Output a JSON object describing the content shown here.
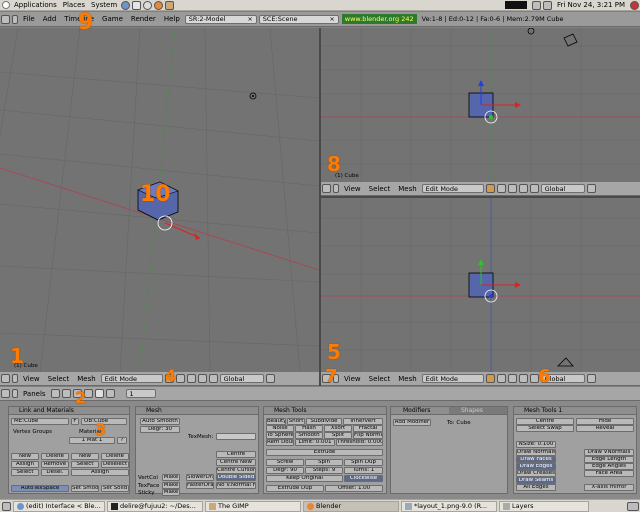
{
  "gnome_top": {
    "menus": [
      "Applications",
      "Places",
      "System"
    ],
    "datetime": "Fri Nov 24,  3:21 PM"
  },
  "blender_header": {
    "menus": [
      "File",
      "Add",
      "Timeline",
      "Game",
      "Render",
      "Help"
    ],
    "screen": "SR:2-Model",
    "scene": "SCE:Scene",
    "url": "www.blender.org 242",
    "stats": "Ve:1-8 | Ed:0-12 | Fa:0-6 | Mem:2.79M Cube"
  },
  "viewports": {
    "object_label": "(1) Cube",
    "menus": [
      "View",
      "Select",
      "Mesh"
    ],
    "mode": "Edit Mode",
    "orientation": "Global"
  },
  "buttons_header": {
    "panels_label": "Panels",
    "frame": "1"
  },
  "panels": {
    "link_materials": {
      "title": "Link and Materials",
      "me": "ME:Cube",
      "f": "F",
      "ob": "OB:Cube",
      "vertex_groups": "Vertex Groups",
      "material": "Material",
      "mat": "1 Mat 1",
      "q": "?",
      "buttons": [
        "New",
        "Delete",
        "New",
        "Delete",
        "Assign",
        "Remove",
        "Select",
        "Deselect",
        "Select",
        "Desel.",
        "Assign"
      ],
      "autotex": "AutoTexSpace",
      "set_smooth": "Set Smooth",
      "set_solid": "Set Solid"
    },
    "mesh": {
      "title": "Mesh",
      "auto_smooth": "Auto Smooth",
      "degr": "Degr: 30",
      "tex_mesh": "TexMesh:",
      "centre": "Centre",
      "centre_new": "Centre New",
      "centre_cursor": "Centre Cursor",
      "rows": [
        {
          "label": "VertCol",
          "btn": "Make"
        },
        {
          "label": "TexFace",
          "btn": "Make"
        },
        {
          "label": "Sticky",
          "btn": "Make"
        }
      ],
      "slower_draw": "SlowerDraw",
      "faster_draw": "FasterDraw",
      "double_sided": "Double Sided",
      "no_v_normal_flip": "No V.Normal Flip"
    },
    "mesh_tools": {
      "title": "Mesh Tools",
      "rows": [
        [
          "Beauty",
          "Short",
          "Subdivide",
          "Innervert"
        ],
        [
          "Noise",
          "Hash",
          "Xsort",
          "Fractal"
        ],
        [
          "To Sphere",
          "Smooth",
          "Split",
          "Flip Normals"
        ],
        [
          "Rem Doubles",
          "Limit: 0.001",
          "Threshold: 0.000"
        ]
      ],
      "extrude": "Extrude",
      "screw": "Screw",
      "spin": "Spin",
      "spin_dup": "Spin Dup",
      "degr": "Degr: 90",
      "steps": "Steps: 9",
      "turns": "Turns: 1",
      "keep_original": "Keep Original",
      "clockwise": "Clockwise",
      "extrude_dup": "Extrude Dup",
      "offset": "Offset: 1.00"
    },
    "modifiers": {
      "tab1": "Modifiers",
      "tab2": "Shapes",
      "add_modifier": "Add Modifier",
      "to": "To: Cube"
    },
    "mesh_tools1": {
      "title": "Mesh Tools 1",
      "centre": "Centre",
      "hide": "Hide",
      "select_swap": "Select Swap",
      "reveal": "Reveal",
      "nsize": "NSize: 0.100",
      "left": [
        "Draw Normals",
        "Draw Faces",
        "Draw Edges",
        "Draw Creases",
        "Draw Seams",
        "All Edges"
      ],
      "right": [
        "Draw VNormals",
        "Edge Length",
        "Edge Angles",
        "Face Area"
      ],
      "xaxis": "X-axis mirror"
    }
  },
  "taskbar": [
    "(edit) Interface < Ble...",
    "delire@fujuu2: ~/Des...",
    "The GIMP",
    "Blender",
    "*layout_1.png-9.0 (R...",
    "Layers"
  ],
  "annotations": [
    "1",
    "2",
    "3",
    "4",
    "5",
    "6",
    "7",
    "8",
    "9",
    "10"
  ]
}
